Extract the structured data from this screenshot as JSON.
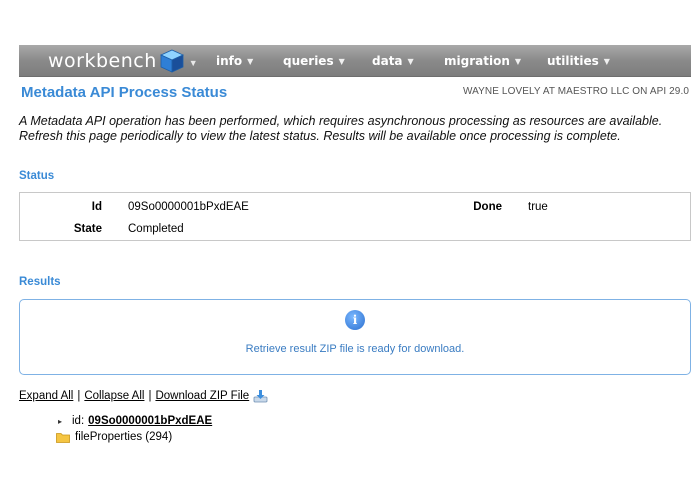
{
  "nav": {
    "brand": "workbench",
    "items": [
      {
        "label": "info"
      },
      {
        "label": "queries"
      },
      {
        "label": "data"
      },
      {
        "label": "migration"
      },
      {
        "label": "utilities"
      }
    ]
  },
  "page": {
    "title": "Metadata API Process Status",
    "user_info": "WAYNE LOVELY AT MAESTRO LLC ON API 29.0",
    "intro": "A Metadata API operation has been performed, which requires asynchronous processing as resources are available. Refresh this page periodically to view the latest status. Results will be available once processing is complete."
  },
  "status": {
    "section_label": "Status",
    "id_label": "Id",
    "id_value": "09So0000001bPxdEAE",
    "done_label": "Done",
    "done_value": "true",
    "state_label": "State",
    "state_value": "Completed"
  },
  "results": {
    "section_label": "Results",
    "message": "Retrieve result ZIP file is ready for download.",
    "icon_glyph": "i"
  },
  "links": {
    "expand_all": "Expand All",
    "separator": "|",
    "collapse_all": "Collapse All",
    "download_zip": "Download ZIP File"
  },
  "tree": {
    "id_label": "id:",
    "id_value": "09So0000001bPxdEAE",
    "file_properties": "fileProperties (294)"
  },
  "colors": {
    "accent": "#3a8ad6",
    "navbar": "#8a8a8a",
    "results_border": "#7fb2e5"
  }
}
